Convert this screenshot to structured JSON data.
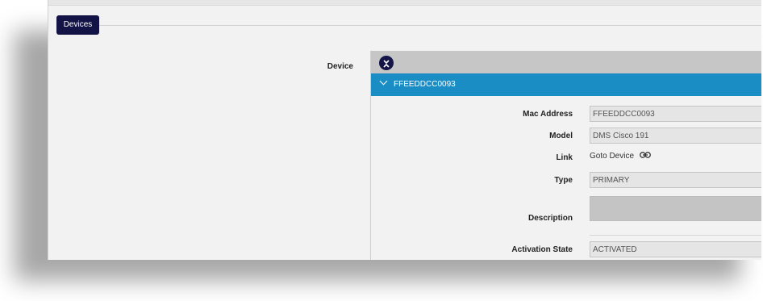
{
  "tab": {
    "label": "Devices"
  },
  "device": {
    "label": "Device",
    "collapse_icon": "chevron-collapse-icon",
    "item_title": "FFEEDDCC0093",
    "fields": {
      "mac_address": {
        "label": "Mac Address",
        "value": "FFEEDDCC0093"
      },
      "model": {
        "label": "Model",
        "value": "DMS Cisco 191"
      },
      "link": {
        "label": "Link",
        "text": "Goto Device",
        "icon": "link-icon"
      },
      "type": {
        "label": "Type",
        "value": "PRIMARY"
      },
      "description": {
        "label": "Description",
        "value": ""
      },
      "activation_state": {
        "label": "Activation State",
        "value": "ACTIVATED"
      }
    }
  },
  "colors": {
    "navy": "#131346",
    "accent_blue": "#1a8dc4",
    "panel_gray": "#c6c6c6"
  }
}
